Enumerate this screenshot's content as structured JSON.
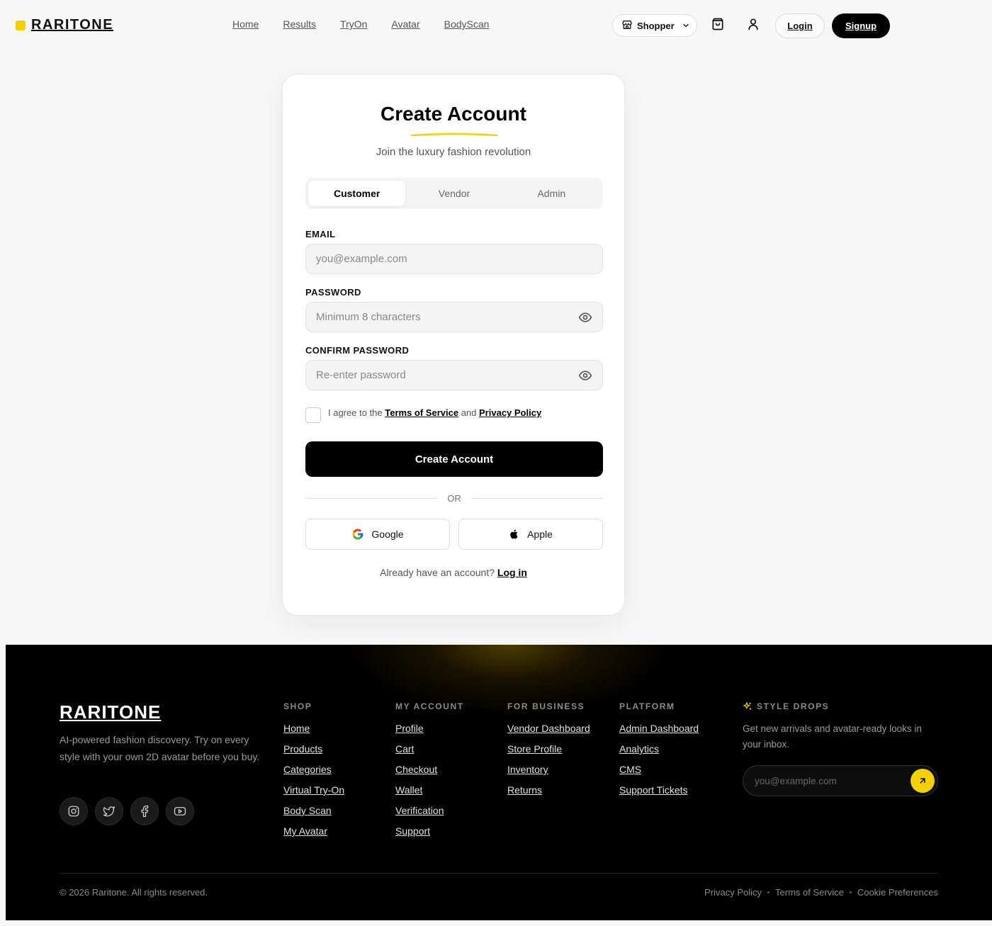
{
  "header": {
    "brand": "RARITONE",
    "nav": [
      "Home",
      "Results",
      "TryOn",
      "Avatar",
      "BodyScan"
    ],
    "role_selected": "Shopper",
    "login_label": "Login",
    "signup_label": "Signup"
  },
  "card": {
    "title": "Create Account",
    "subtitle": "Join the luxury fashion revolution",
    "tabs": [
      "Customer",
      "Vendor",
      "Admin"
    ],
    "active_tab": "Customer",
    "email_label": "EMAIL",
    "email_placeholder": "you@example.com",
    "password_label": "PASSWORD",
    "password_placeholder": "Minimum 8 characters",
    "confirm_label": "CONFIRM PASSWORD",
    "confirm_placeholder": "Re-enter password",
    "agree_prefix": "I agree to the",
    "terms_link": "Terms of Service",
    "agree_and": "and",
    "privacy_link": "Privacy Policy",
    "create_button": "Create Account",
    "or_text": "OR",
    "google_label": "Google",
    "apple_label": "Apple",
    "already_text": "Already have an account?",
    "login_link": "Log in"
  },
  "footer": {
    "brand": "RARITONE",
    "tagline": "AI-powered fashion discovery. Try on every style with your own 2D avatar before you buy.",
    "social_icons": [
      "instagram-icon",
      "twitter-icon",
      "facebook-icon",
      "youtube-icon"
    ],
    "columns": [
      {
        "title": "SHOP",
        "links": [
          "Home",
          "Products",
          "Categories",
          "Virtual Try-On",
          "Body Scan",
          "My Avatar"
        ]
      },
      {
        "title": "MY ACCOUNT",
        "links": [
          "Profile",
          "Cart",
          "Checkout",
          "Wallet",
          "Verification",
          "Support"
        ]
      },
      {
        "title": "FOR BUSINESS",
        "links": [
          "Vendor Dashboard",
          "Store Profile",
          "Inventory",
          "Returns"
        ]
      },
      {
        "title": "PLATFORM",
        "links": [
          "Admin Dashboard",
          "Analytics",
          "CMS",
          "Support Tickets"
        ]
      }
    ],
    "drops_title": "STYLE DROPS",
    "drops_text": "Get new arrivals and avatar-ready looks in your inbox.",
    "drops_placeholder": "you@example.com",
    "copyright": "© 2026 Raritone. All rights reserved.",
    "legal": [
      "Privacy Policy",
      "Terms of Service",
      "Cookie Preferences"
    ]
  },
  "colors": {
    "accent": "#f5d000",
    "primary": "#000000",
    "background": "#f7f7f7"
  }
}
